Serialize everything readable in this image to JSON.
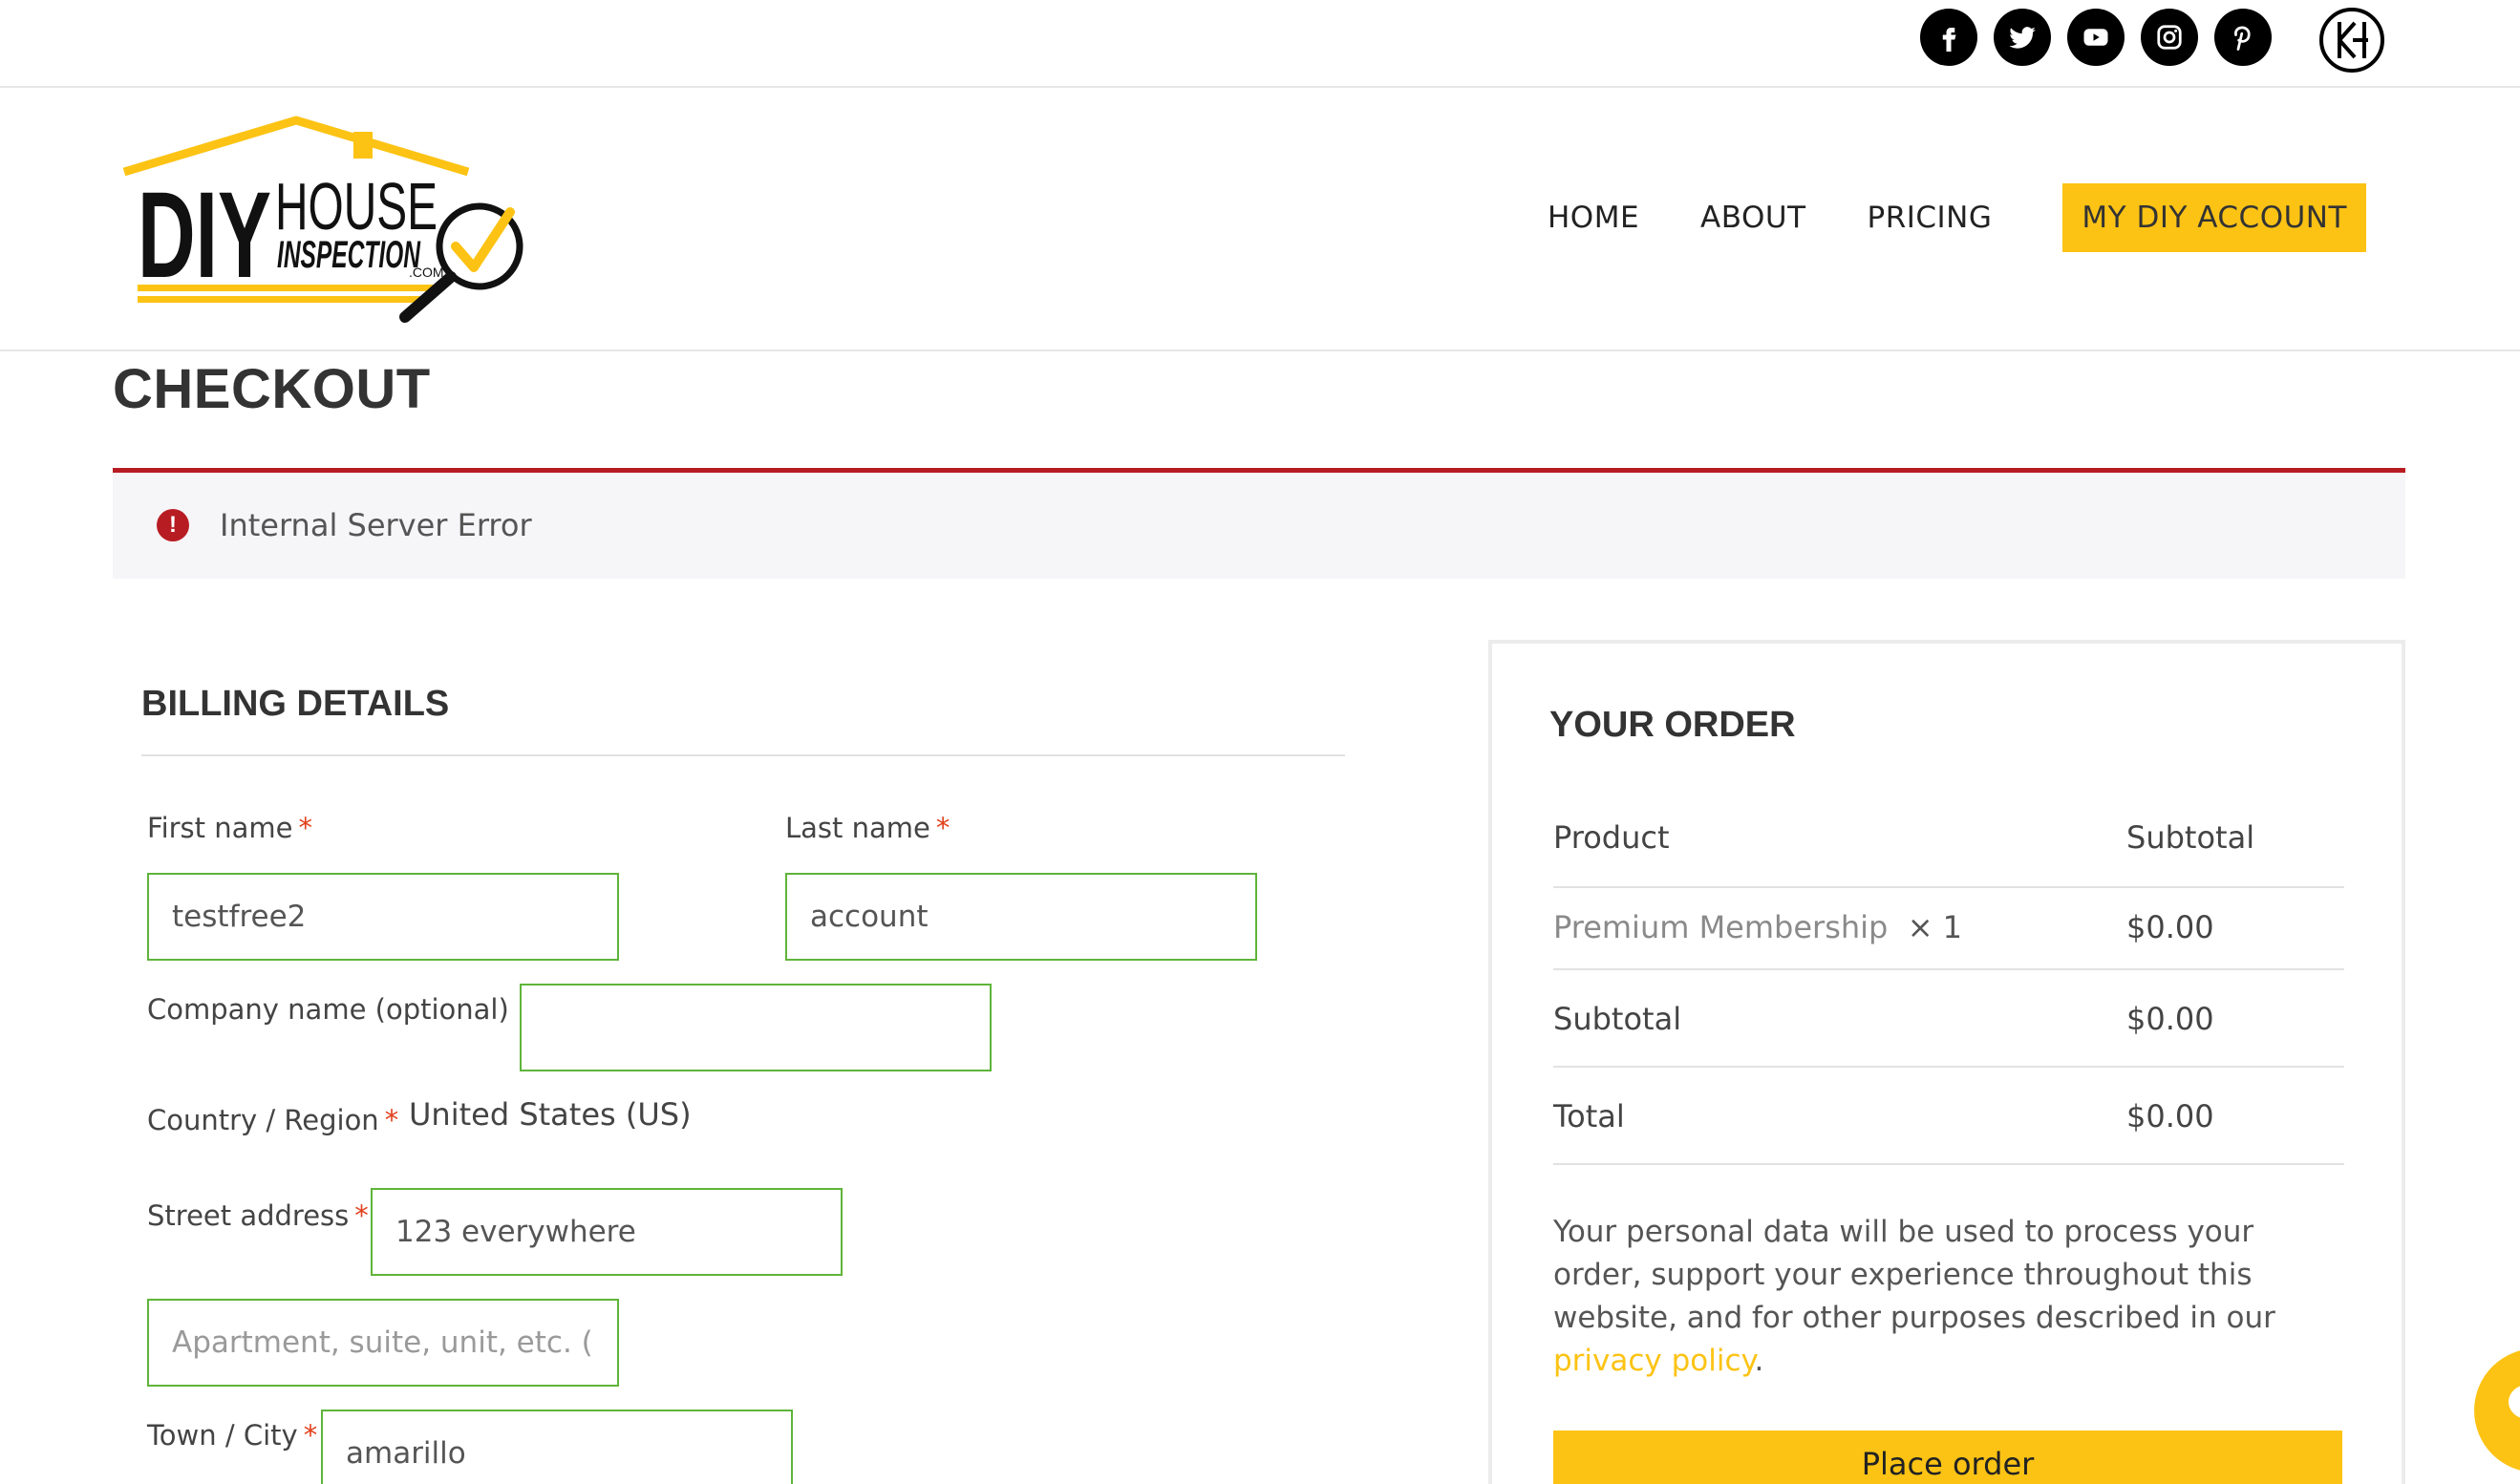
{
  "social": {
    "icons": [
      "facebook-icon",
      "twitter-icon",
      "youtube-icon",
      "instagram-icon",
      "pinterest-icon"
    ],
    "partner_logo": "KH"
  },
  "brand": {
    "logo_text_diy": "DIY",
    "logo_text_house": "HOUSE",
    "logo_text_inspection": "INSPECTION",
    "logo_text_com": ".COM",
    "accent": "#fcc314"
  },
  "nav": {
    "home": "HOME",
    "about": "ABOUT",
    "pricing": "PRICING",
    "account": "MY DIY ACCOUNT"
  },
  "page": {
    "title": "CHECKOUT"
  },
  "notice": {
    "icon": "error-icon",
    "text": "Internal Server Error",
    "color": "#b81c23"
  },
  "billing": {
    "title": "BILLING DETAILS",
    "first_name": {
      "label": "First name",
      "value": "testfree2"
    },
    "last_name": {
      "label": "Last name",
      "value": "account"
    },
    "company": {
      "label": "Company name (optional)",
      "value": ""
    },
    "country": {
      "label": "Country / Region",
      "value": "United States (US)"
    },
    "street": {
      "label": "Street address",
      "value": "123 everywhere",
      "placeholder2": "Apartment, suite, unit, etc. (optional)"
    },
    "city": {
      "label": "Town / City",
      "value": "amarillo"
    },
    "required_mark": "*"
  },
  "order": {
    "title": "YOUR ORDER",
    "headers": {
      "product": "Product",
      "subtotal": "Subtotal"
    },
    "item": {
      "name": "Premium Membership",
      "qty": "× 1",
      "price": "$0.00"
    },
    "subtotal": {
      "label": "Subtotal",
      "value": "$0.00"
    },
    "total": {
      "label": "Total",
      "value": "$0.00"
    },
    "privacy_text": "Your personal data will be used to process your order, support your experience throughout this website, and for other purposes described in our ",
    "privacy_link": "privacy policy",
    "privacy_end": ".",
    "place_order": "Place order"
  }
}
